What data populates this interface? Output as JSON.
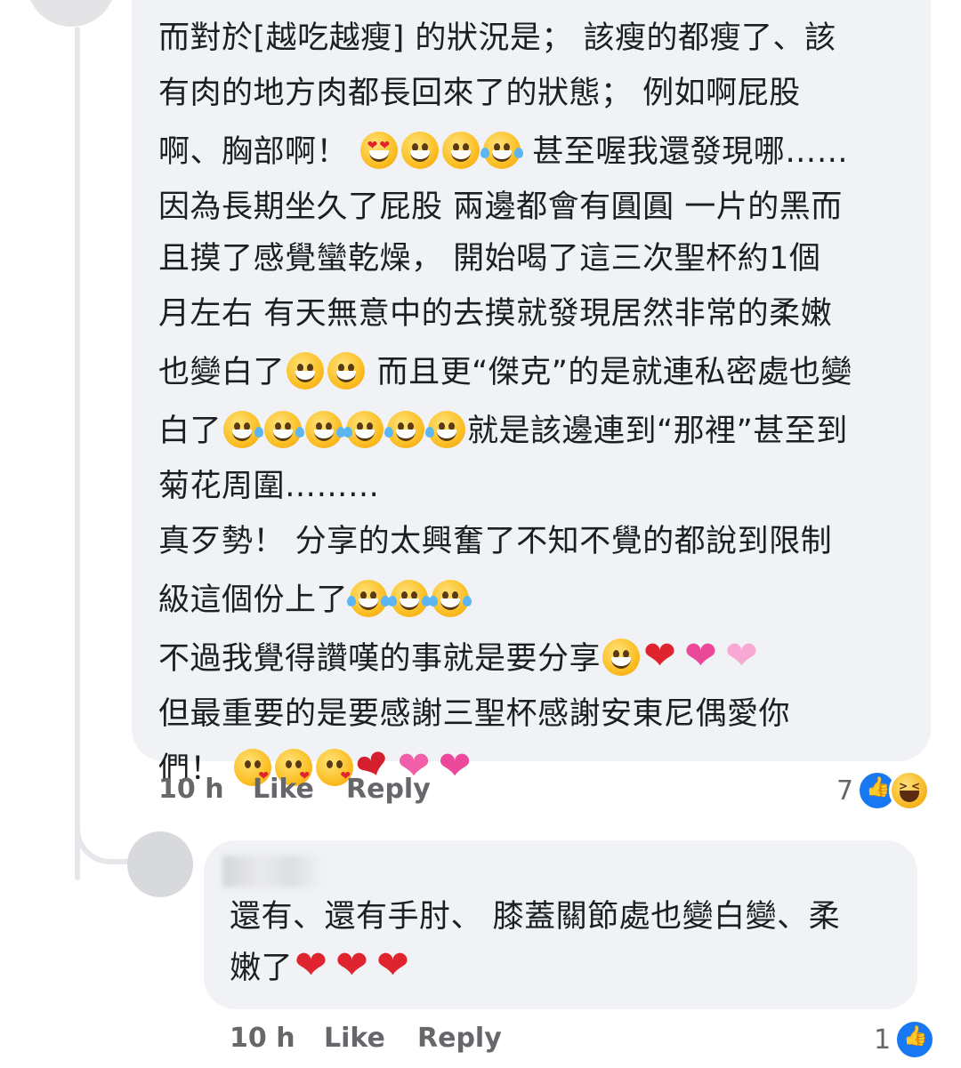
{
  "main_comment": {
    "lines": [
      "而對於[越吃越瘦] 的狀況是； 該瘦的都瘦了、該",
      "有肉的地方肉都長回來了的狀態； 例如啊屁股",
      "啊、胸部啊！",
      "甚至喔我還發現哪……",
      "因為長期坐久了屁股 兩邊都會有圓圓 一片的黑而",
      "且摸了感覺蠻乾燥， 開始喝了這三次聖杯約1個",
      "月左右 有天無意中的去摸就發現居然非常的柔嫩",
      "也變白了",
      "而且更“傑克”的是就連私密處也變",
      "白了",
      "就是該邊連到“那裡”甚至到",
      "菊花周圍………",
      "真歹勢！ 分享的太興奮了不知不覺的都說到限制",
      "級這個份上了",
      "不過我覺得讚嘆的事就是要分享",
      "但最重要的是要感謝三聖杯感謝安東尼偶愛你",
      "們！"
    ],
    "time": "10 h",
    "like_label": "Like",
    "reply_label": "Reply",
    "reaction_count": "7",
    "reaction_icons": [
      "like-reaction-icon",
      "haha-reaction-icon"
    ]
  },
  "reply_comment": {
    "lines": [
      "還有、還有手肘、 膝蓋關節處也變白變、柔",
      "嫩了"
    ],
    "time": "10 h",
    "like_label": "Like",
    "reply_label": "Reply",
    "reaction_count": "1",
    "reaction_icons": [
      "like-reaction-icon"
    ]
  },
  "colors": {
    "bubble_bg": "#f0f2f5",
    "text": "#1c1e21",
    "meta_text": "#65676b",
    "like_blue": "#1877f2",
    "heart_red": "#e0242f"
  }
}
